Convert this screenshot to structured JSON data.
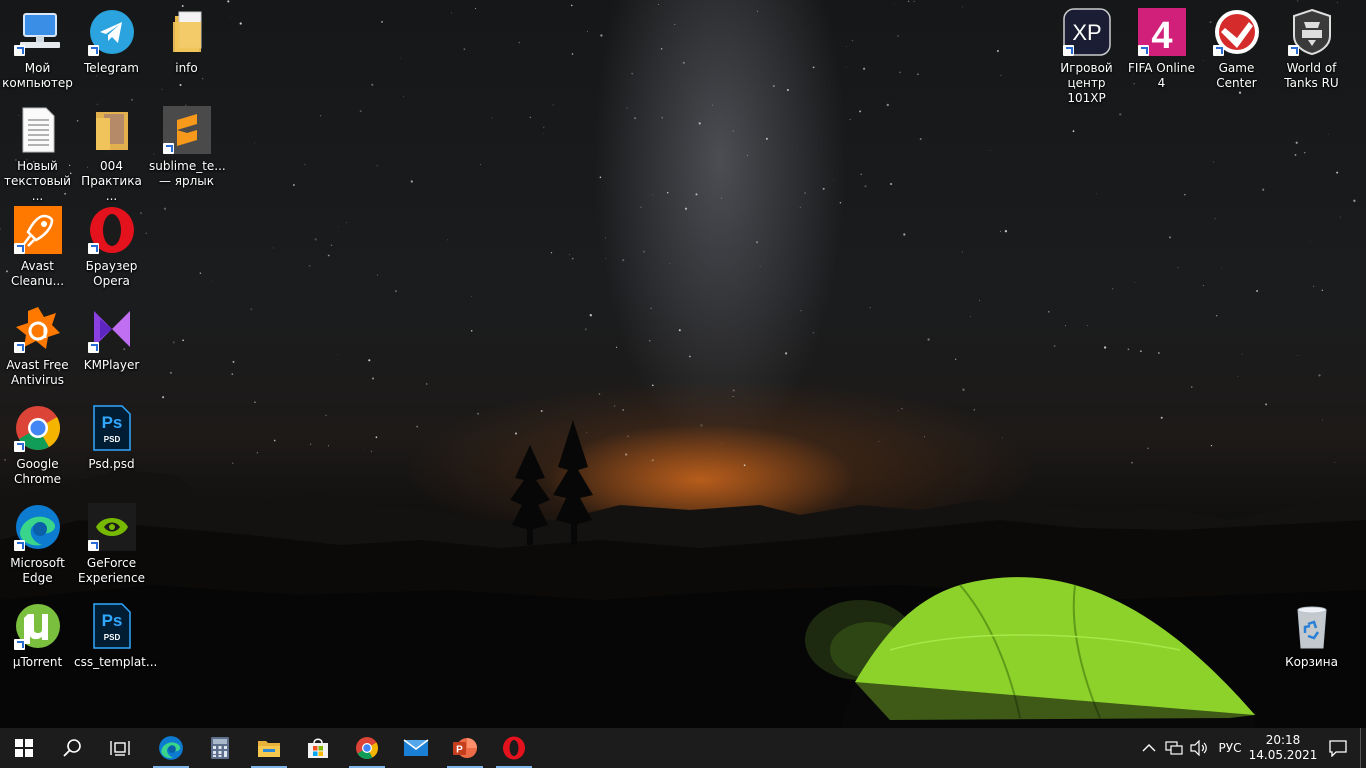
{
  "desktop_icons_left": [
    {
      "label": "Мой компьютер",
      "icon": "computer-icon"
    },
    {
      "label": "Telegram",
      "icon": "telegram-icon"
    },
    {
      "label": "info",
      "icon": "folder-icon"
    },
    {
      "label": "Новый текстовый ...",
      "icon": "text-file-icon"
    },
    {
      "label": "004 Практика ...",
      "icon": "folder-icon"
    },
    {
      "label": "sublime_te... — ярлык",
      "icon": "sublime-icon"
    },
    {
      "label": "Avast Cleanu...",
      "icon": "avast-cleanup-icon"
    },
    {
      "label": "Браузер Opera",
      "icon": "opera-icon"
    },
    {
      "label": "Avast Free Antivirus",
      "icon": "avast-icon"
    },
    {
      "label": "KMPlayer",
      "icon": "kmplayer-icon"
    },
    {
      "label": "Google Chrome",
      "icon": "chrome-icon"
    },
    {
      "label": "Psd.psd",
      "icon": "psd-icon"
    },
    {
      "label": "Microsoft Edge",
      "icon": "edge-icon"
    },
    {
      "label": "GeForce Experience",
      "icon": "nvidia-icon"
    },
    {
      "label": "µTorrent",
      "icon": "utorrent-icon"
    },
    {
      "label": "css_templat...",
      "icon": "psd-icon"
    }
  ],
  "desktop_icons_right": [
    {
      "label": "Игровой центр 101XP",
      "icon": "xp-icon",
      "glyph": "XP"
    },
    {
      "label": "FIFA Online 4",
      "icon": "fifa-icon",
      "glyph": "4"
    },
    {
      "label": "Game Center",
      "icon": "game-center-icon"
    },
    {
      "label": "World of Tanks RU",
      "icon": "wot-icon"
    }
  ],
  "recycle_bin": {
    "label": "Корзина",
    "icon": "recycle-bin-icon"
  },
  "icon_text": {
    "ps": "Ps",
    "psd": "PSD"
  },
  "taskbar": {
    "pinned": [
      {
        "icon": "edge-icon",
        "active": true
      },
      {
        "icon": "calculator-icon",
        "active": false
      },
      {
        "icon": "file-explorer-icon",
        "active": true
      },
      {
        "icon": "store-icon",
        "active": false
      },
      {
        "icon": "chrome-icon",
        "active": true
      },
      {
        "icon": "mail-icon",
        "active": false
      },
      {
        "icon": "powerpoint-icon",
        "active": true
      },
      {
        "icon": "opera-icon",
        "active": true
      }
    ],
    "language": "РУС",
    "time": "20:18",
    "date": "14.05.2021"
  },
  "colors": {
    "taskbar": "#1c1c1c",
    "tent": "#8cd22a",
    "accent": "#7fb4e8"
  }
}
